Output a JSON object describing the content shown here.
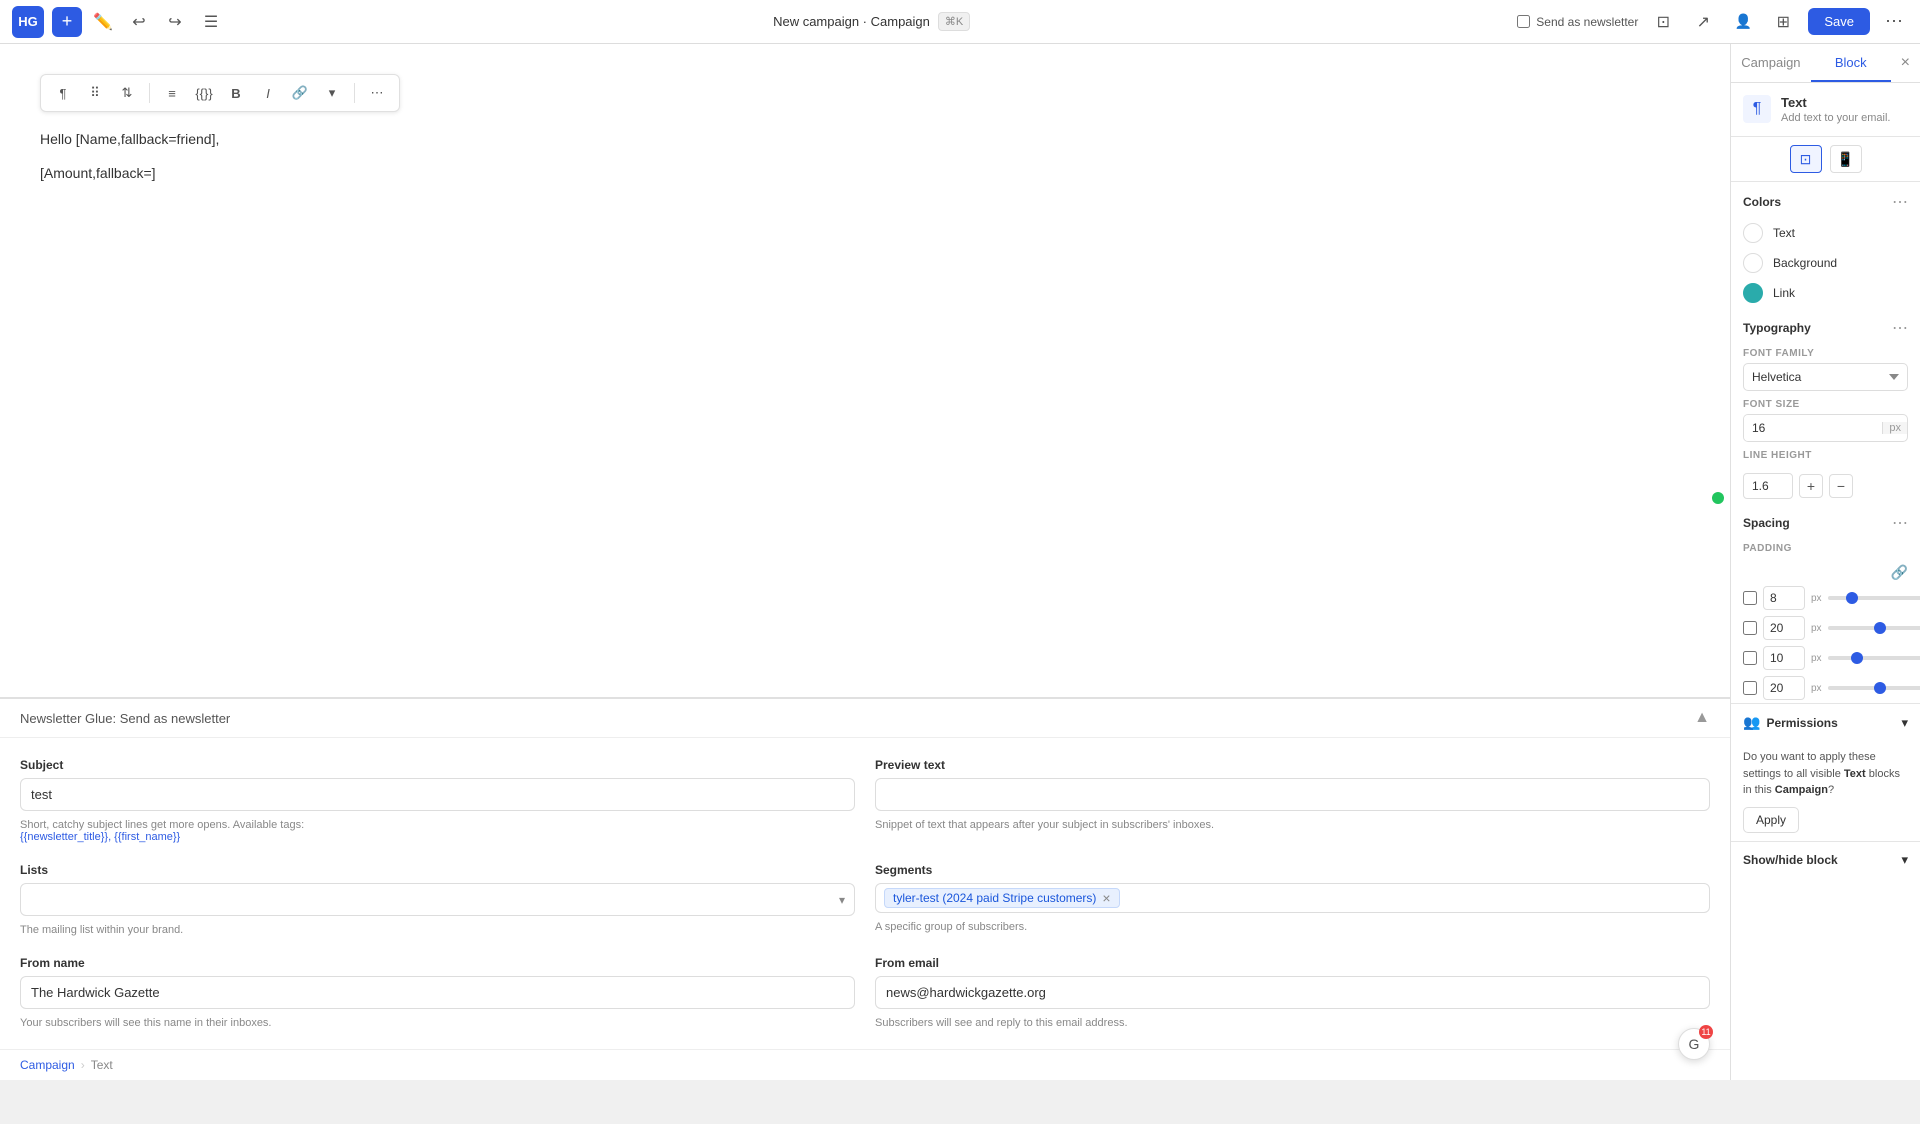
{
  "topbar": {
    "logo": "HG",
    "add_label": "+",
    "campaign_title": "New campaign · Campaign",
    "shortcut": "⌘K",
    "send_newsletter_label": "Send as newsletter",
    "save_label": "Save"
  },
  "editor": {
    "line1": "Hello [Name,fallback=friend],",
    "line2": "[Amount,fallback=]",
    "toolbar": {
      "paragraph": "¶",
      "grid": "⠿",
      "arrows": "⇅",
      "align": "≡",
      "code": "{}",
      "bold": "B",
      "italic": "I",
      "link": "🔗",
      "chevron": "▾",
      "more": "⋯"
    }
  },
  "bottom_panel": {
    "title": "Newsletter Glue: Send as newsletter",
    "subject_label": "Subject",
    "subject_value": "test",
    "subject_hint": "Short, catchy subject lines get more opens. Available tags:",
    "subject_tags": "{{newsletter_title}}, {{first_name}}",
    "preview_label": "Preview text",
    "preview_placeholder": "",
    "preview_hint": "Snippet of text that appears after your subject in subscribers' inboxes.",
    "lists_label": "Lists",
    "lists_hint": "The mailing list within your brand.",
    "segments_label": "Segments",
    "segment_tag": "tyler-test (2024 paid Stripe customers)",
    "segments_hint": "A specific group of subscribers.",
    "from_name_label": "From name",
    "from_name_value": "The Hardwick Gazette",
    "from_name_hint": "Your subscribers will see this name in their inboxes.",
    "from_email_label": "From email",
    "from_email_value": "news@hardwickgazette.org",
    "from_email_hint": "Subscribers will see and reply to this email address."
  },
  "breadcrumb": {
    "campaign": "Campaign",
    "sep": "›",
    "text": "Text"
  },
  "right_panel": {
    "tab_campaign": "Campaign",
    "tab_block": "Block",
    "block_title": "Text",
    "block_desc": "Add text to your email.",
    "device_desktop": "🖥",
    "device_mobile": "📱",
    "colors_title": "Colors",
    "color_text_label": "Text",
    "color_bg_label": "Background",
    "color_link_label": "Link",
    "color_link_hex": "#2aabab",
    "typography_title": "Typography",
    "font_family_label": "FONT FAMILY",
    "font_family_value": "Helvetica",
    "font_size_label": "FONT SIZE",
    "font_size_value": "16",
    "font_size_unit": "px",
    "line_height_label": "LINE HEIGHT",
    "line_height_value": "1.6",
    "spacing_title": "Spacing",
    "padding_label": "PADDING",
    "padding_top": "8",
    "padding_right": "20",
    "padding_bottom": "10",
    "padding_left": "20",
    "permissions_title": "Permissions",
    "permissions_text": "Do you want to apply these settings to all visible ",
    "permissions_text2": "Text",
    "permissions_text3": " blocks in this ",
    "permissions_text4": "Campaign",
    "permissions_text5": "?",
    "apply_label": "Apply",
    "show_hide_label": "Show/hide block"
  }
}
